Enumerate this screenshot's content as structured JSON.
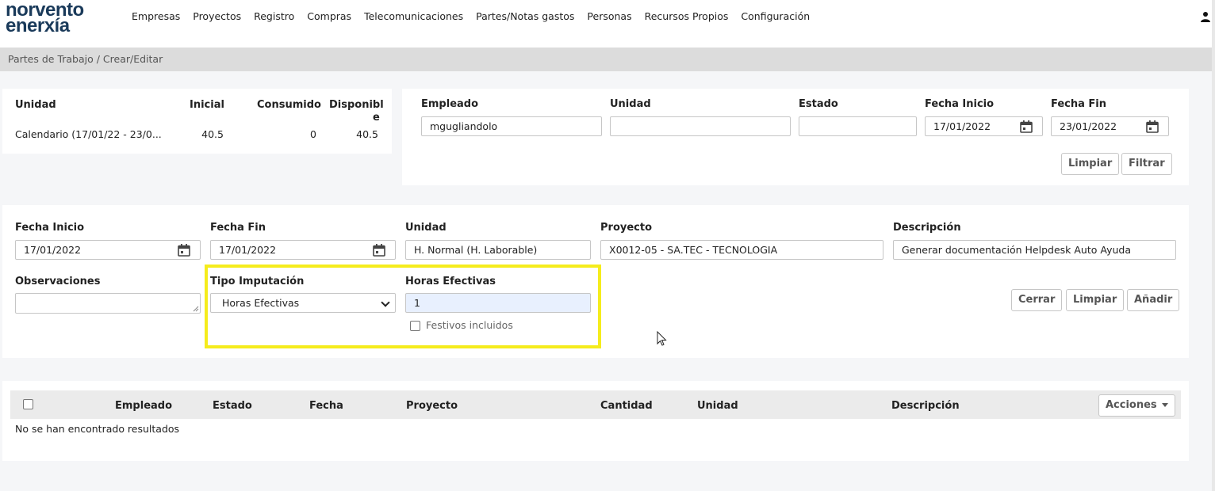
{
  "brand": {
    "line1": "norvento",
    "line2": "enerxía"
  },
  "nav": [
    "Empresas",
    "Proyectos",
    "Registro",
    "Compras",
    "Telecomunicaciones",
    "Partes/Notas gastos",
    "Personas",
    "Recursos Propios",
    "Configuración"
  ],
  "breadcrumb": "Partes de Trabajo  /  Crear/Editar",
  "summary": {
    "headers": {
      "unidad": "Unidad",
      "inicial": "Inicial",
      "consumido": "Consumido",
      "disponible_1": "Disponibl",
      "disponible_2": "e"
    },
    "row": {
      "unidad": "Calendario (17/01/22 - 23/0...",
      "inicial": "40.5",
      "consumido": "0",
      "disponible": "40.5"
    }
  },
  "filter": {
    "empleado_label": "Empleado",
    "empleado_value": "mgugliandolo",
    "unidad_label": "Unidad",
    "unidad_value": "",
    "estado_label": "Estado",
    "estado_value": "",
    "fecha_inicio_label": "Fecha Inicio",
    "fecha_inicio_value": "17/01/2022",
    "fecha_fin_label": "Fecha Fin",
    "fecha_fin_value": "23/01/2022",
    "limpiar": "Limpiar",
    "filtrar": "Filtrar"
  },
  "form": {
    "fecha_inicio_label": "Fecha Inicio",
    "fecha_inicio_value": "17/01/2022",
    "fecha_fin_label": "Fecha Fin",
    "fecha_fin_value": "17/01/2022",
    "unidad_label": "Unidad",
    "unidad_value": "H. Normal (H. Laborable)",
    "proyecto_label": "Proyecto",
    "proyecto_value": "X0012-05 - SA.TEC - TECNOLOGIA",
    "descripcion_label": "Descripción",
    "descripcion_value": "Generar documentación Helpdesk Auto Ayuda",
    "observaciones_label": "Observaciones",
    "observaciones_value": "",
    "tipo_label": "Tipo Imputación",
    "tipo_value": "Horas Efectivas",
    "horas_label": "Horas Efectivas",
    "horas_value": "1",
    "festivos_label": "Festivos incluidos",
    "cerrar": "Cerrar",
    "limpiar": "Limpiar",
    "anadir": "Añadir"
  },
  "table": {
    "columns": [
      "Empleado",
      "Estado",
      "Fecha",
      "Proyecto",
      "Cantidad",
      "Unidad",
      "Descripción"
    ],
    "acciones": "Acciones",
    "empty": "No se han encontrado resultados"
  },
  "colors": {
    "highlight": "#f5ec1c",
    "brand": "#1a3a5a",
    "input_focus": "#e8f0fe"
  }
}
